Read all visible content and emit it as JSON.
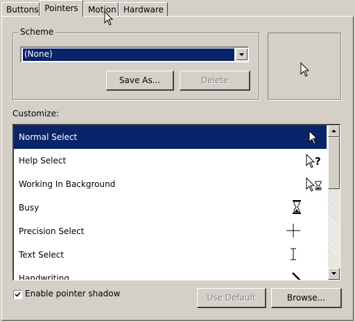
{
  "tabs": [
    {
      "label": "Buttons",
      "active": false
    },
    {
      "label": "Pointers",
      "active": true
    },
    {
      "label": "Motion",
      "active": false
    },
    {
      "label": "Hardware",
      "active": false
    }
  ],
  "scheme": {
    "legend": "Scheme",
    "selected": "(None)",
    "save_as_label": "Save As...",
    "delete_label": "Delete",
    "delete_disabled": true
  },
  "customize": {
    "label": "Customize:",
    "items": [
      {
        "label": "Normal Select",
        "icon": "arrow-pointer-icon",
        "selected": true
      },
      {
        "label": "Help Select",
        "icon": "help-pointer-icon",
        "selected": false
      },
      {
        "label": "Working In Background",
        "icon": "working-background-icon",
        "selected": false
      },
      {
        "label": "Busy",
        "icon": "hourglass-icon",
        "selected": false
      },
      {
        "label": "Precision Select",
        "icon": "crosshair-icon",
        "selected": false
      },
      {
        "label": "Text Select",
        "icon": "ibeam-icon",
        "selected": false
      },
      {
        "label": "Handwriting",
        "icon": "pen-icon",
        "selected": false
      }
    ]
  },
  "shadow": {
    "label": "Enable pointer shadow",
    "checked": true
  },
  "footer": {
    "use_default_label": "Use Default",
    "use_default_disabled": true,
    "browse_label": "Browse..."
  },
  "colors": {
    "selection": "#0a246a",
    "face": "#d4d0c8"
  }
}
